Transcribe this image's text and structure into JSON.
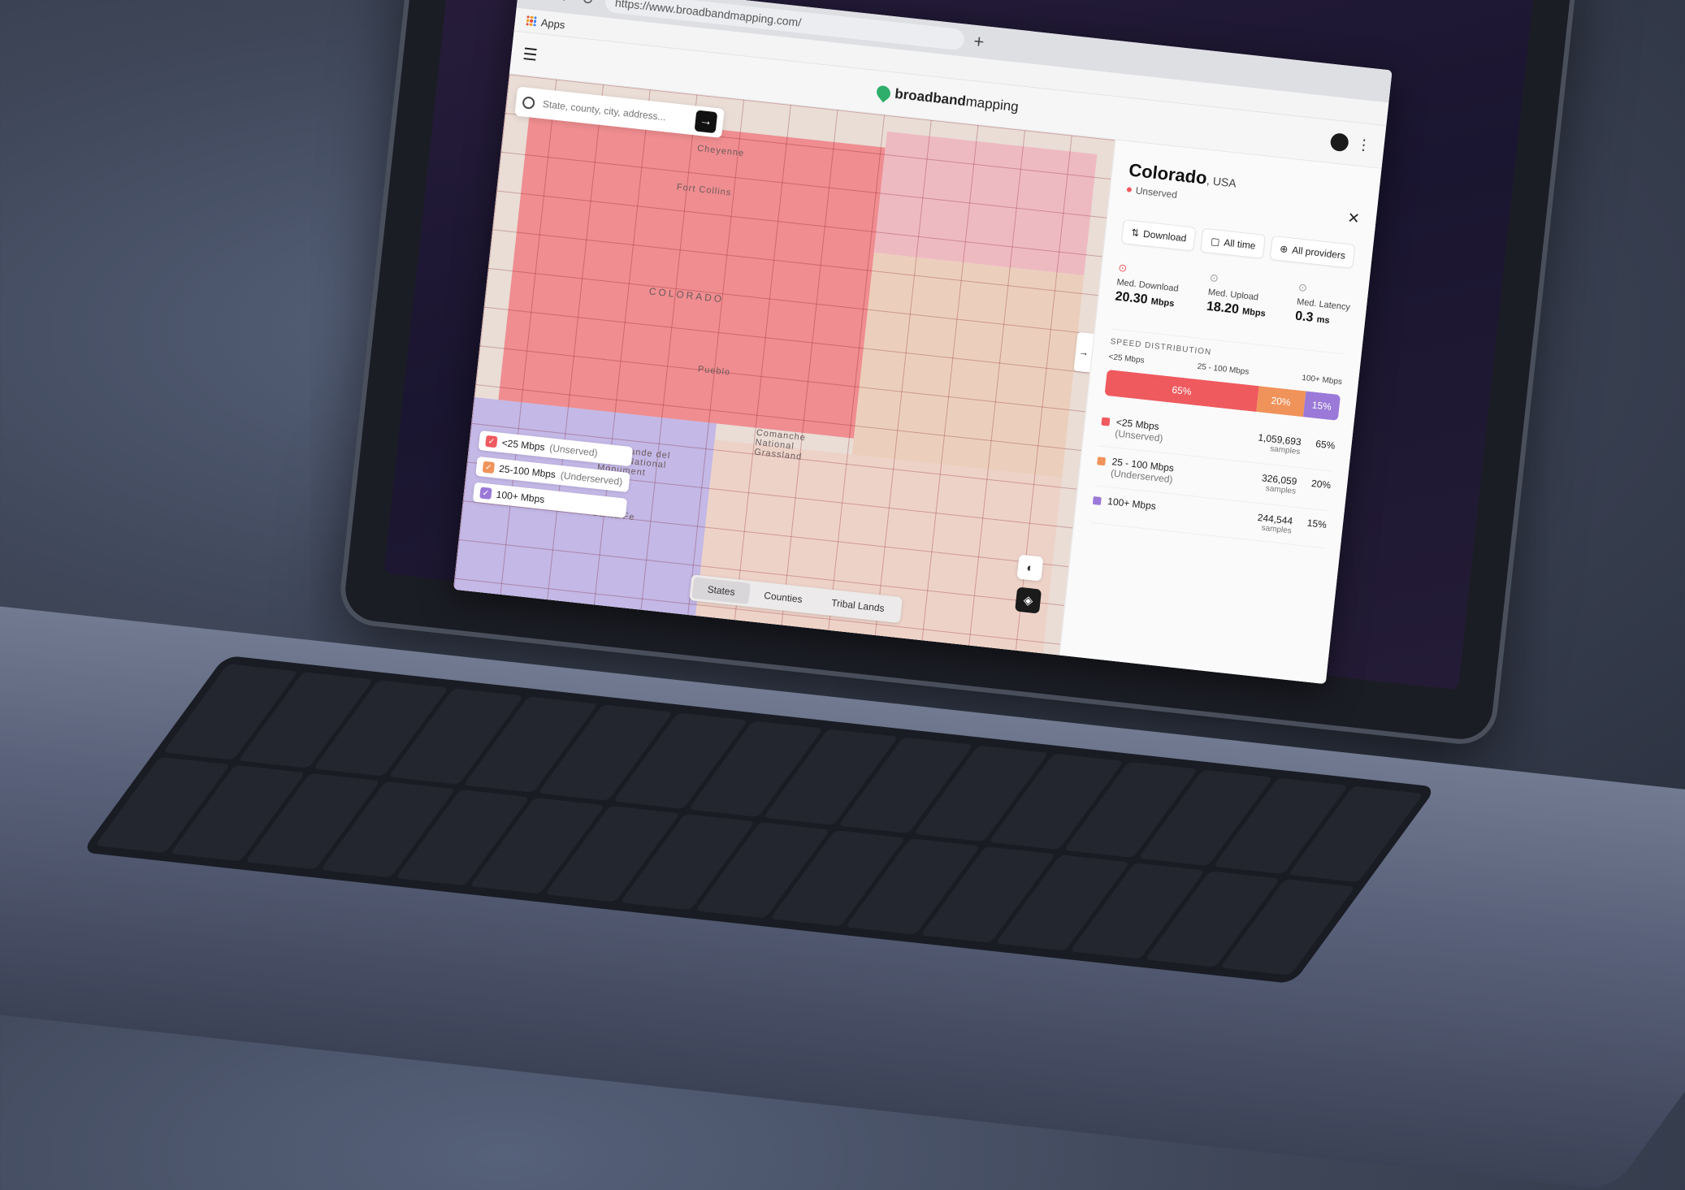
{
  "browser": {
    "url": "https://www.broadbandmapping.com/",
    "bookmark_apps": "Apps",
    "new_tab": "+"
  },
  "app": {
    "logo_bold": "broadband",
    "logo_light": "mapping"
  },
  "search": {
    "placeholder": "State, county, city, address..."
  },
  "map": {
    "labels": [
      "Cheyenne",
      "Fort Collins",
      "COLORADO",
      "Pueblo",
      "Rio Grande del Norte National Monument",
      "Comanche National Grassland",
      "Santa Fe"
    ],
    "legend": [
      {
        "label": "<25 Mbps",
        "sub": "(Unserved)",
        "color": "#ef5a5f"
      },
      {
        "label": "25-100 Mbps",
        "sub": "(Underserved)",
        "color": "#f0935a"
      },
      {
        "label": "100+ Mbps",
        "sub": "",
        "color": "#9a79d8"
      }
    ],
    "tabs": [
      "States",
      "Counties",
      "Tribal Lands"
    ],
    "active_tab": "States"
  },
  "panel": {
    "title": "Colorado",
    "title_suffix": ", USA",
    "status": "Unserved",
    "filters": {
      "download": "Download",
      "time": "All time",
      "providers": "All providers"
    },
    "metrics": [
      {
        "label": "Med. Download",
        "value": "20.30",
        "unit": "Mbps"
      },
      {
        "label": "Med. Upload",
        "value": "18.20",
        "unit": "Mbps"
      },
      {
        "label": "Med. Latency",
        "value": "0.3",
        "unit": "ms"
      }
    ],
    "section_title": "SPEED DISTRIBUTION",
    "bar_label_left": "<25 Mbps",
    "bar_label_mid": "25 - 100 Mbps",
    "bar_label_right": "100+ Mbps",
    "distribution": [
      {
        "label": "<25 Mbps",
        "sub": "(Unserved)",
        "samples": "1,059,693",
        "samples_label": "samples",
        "pct": "65%",
        "share": 0.65,
        "color": "#ef5a5f"
      },
      {
        "label": "25 - 100 Mbps",
        "sub": "(Underserved)",
        "samples": "326,059",
        "samples_label": "samples",
        "pct": "20%",
        "share": 0.2,
        "color": "#f0935a"
      },
      {
        "label": "100+ Mbps",
        "sub": "",
        "samples": "244,544",
        "samples_label": "samples",
        "pct": "15%",
        "share": 0.15,
        "color": "#9a79d8"
      }
    ]
  }
}
